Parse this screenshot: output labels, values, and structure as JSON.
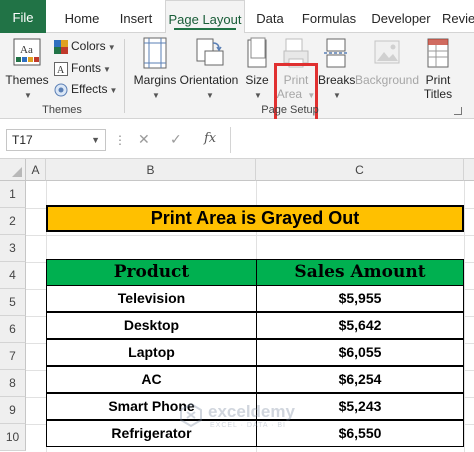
{
  "tabs": [
    {
      "label": "File"
    },
    {
      "label": "Home"
    },
    {
      "label": "Insert"
    },
    {
      "label": "Page Layout"
    },
    {
      "label": "Data"
    },
    {
      "label": "Formulas"
    },
    {
      "label": "Developer"
    },
    {
      "label": "Review"
    }
  ],
  "ribbon": {
    "themes_group": {
      "themes_label": "Themes",
      "colors_label": "Colors",
      "fonts_label": "Fonts",
      "effects_label": "Effects",
      "group_label": "Themes"
    },
    "page_setup_group": {
      "margins_label": "Margins",
      "orientation_label": "Orientation",
      "size_label": "Size",
      "print_area_line1": "Print",
      "print_area_line2": "Area",
      "breaks_label": "Breaks",
      "background_label": "Background",
      "print_titles_line1": "Print",
      "print_titles_line2": "Titles",
      "group_label": "Page Setup"
    },
    "highlight_color": "#e03030"
  },
  "formula_bar": {
    "name_box": "T17",
    "fx_label": "fx",
    "formula": ""
  },
  "sheet": {
    "columns": [
      "A",
      "B",
      "C"
    ],
    "rows": [
      "1",
      "2",
      "3",
      "4",
      "5",
      "6",
      "7",
      "8",
      "9",
      "10"
    ],
    "title": "Print Area is Grayed Out",
    "header": {
      "product": "Product",
      "sales": "Sales Amount"
    },
    "data": [
      {
        "product": "Television",
        "sales": "$5,955"
      },
      {
        "product": "Desktop",
        "sales": "$5,642"
      },
      {
        "product": "Laptop",
        "sales": "$6,055"
      },
      {
        "product": "AC",
        "sales": "$6,254"
      },
      {
        "product": "Smart Phone",
        "sales": "$5,243"
      },
      {
        "product": "Refrigerator",
        "sales": "$6,550"
      }
    ],
    "colors": {
      "title_fill": "#ffc000",
      "header_fill": "#00b050",
      "accent": "#217346"
    }
  },
  "watermark": {
    "name": "exceldemy",
    "tagline": "EXCEL · DATA · BI"
  }
}
